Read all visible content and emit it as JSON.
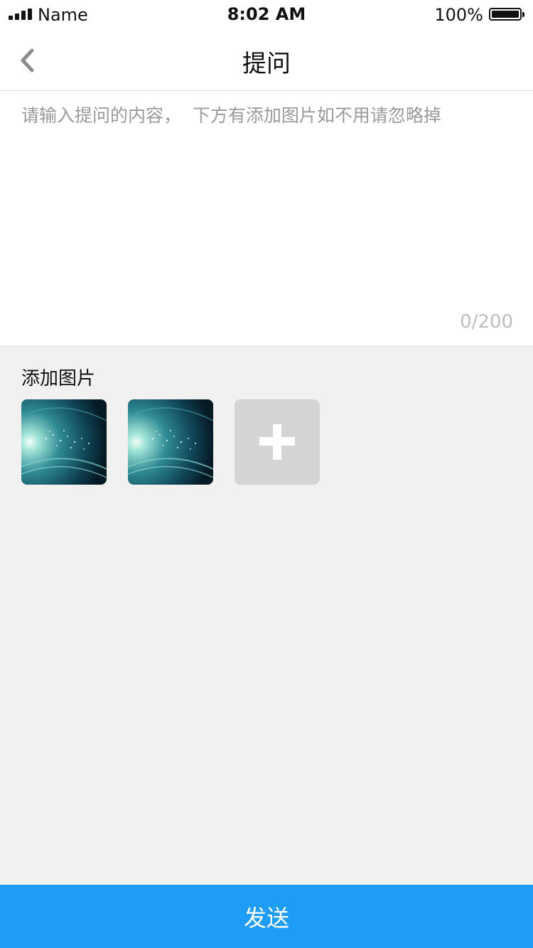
{
  "status_bar": {
    "carrier": "Name",
    "time": "8:02 AM",
    "battery_percent": "100%"
  },
  "nav": {
    "title": "提问",
    "back_icon": "chevron-left-icon"
  },
  "question": {
    "placeholder": "请输入提问的内容，  下方有添加图片如不用请忽略掉",
    "value": "",
    "counter": "0/200"
  },
  "images": {
    "label": "添加图片",
    "items": [
      {
        "name": "attached-image-1"
      },
      {
        "name": "attached-image-2"
      }
    ],
    "add_icon": "plus-icon"
  },
  "send": {
    "label": "发送",
    "color": "#1e9cf6"
  }
}
